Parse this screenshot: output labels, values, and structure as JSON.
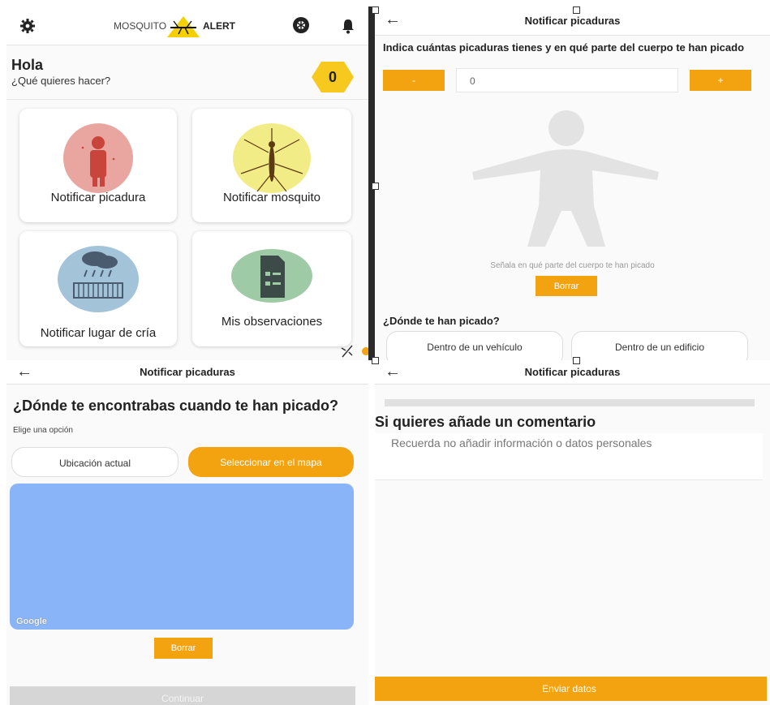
{
  "home": {
    "logo_left": "MOSQUITO",
    "logo_right": "ALERT",
    "greeting": "Hola",
    "subtitle": "¿Qué quieres hacer?",
    "score": "0",
    "cards": [
      {
        "label": "Notificar picadura",
        "icon": "bite-person-icon",
        "color": "#e9a6a0"
      },
      {
        "label": "Notificar mosquito",
        "icon": "mosquito-icon",
        "color": "#f2ec86"
      },
      {
        "label": "Notificar lugar de cría",
        "icon": "rain-breeding-site-icon",
        "color": "#a2c3d8"
      },
      {
        "label": "Mis observaciones",
        "icon": "document-list-icon",
        "color": "#9fcaa6"
      }
    ]
  },
  "bites": {
    "title": "Notificar picaduras",
    "prompt": "Indica cuántas picaduras tienes y en qué parte del cuerpo te han picado",
    "minus": "-",
    "plus": "+",
    "count": "0",
    "body_hint": "Señala en qué parte del cuerpo te han picado",
    "clear": "Borrar",
    "where_title": "¿Dónde te han picado?",
    "options": [
      "Dentro de un vehículo",
      "Dentro de un edificio"
    ]
  },
  "location": {
    "title": "Notificar picaduras",
    "heading": "¿Dónde te encontrabas cuando te han picado?",
    "sub": "Elige una opción",
    "opt_current": "Ubicación actual",
    "opt_map": "Seleccionar en el mapa",
    "map_brand": "Google",
    "clear": "Borrar",
    "continue": "Continuar"
  },
  "comment": {
    "title": "Notificar picaduras",
    "heading": "Si quieres añade un comentario",
    "placeholder": "Recuerda no añadir información o datos personales",
    "send": "Enviar datos"
  },
  "colors": {
    "accent": "#f2a30f",
    "map": "#8ab4f8",
    "disabled": "#d6d6d6"
  }
}
